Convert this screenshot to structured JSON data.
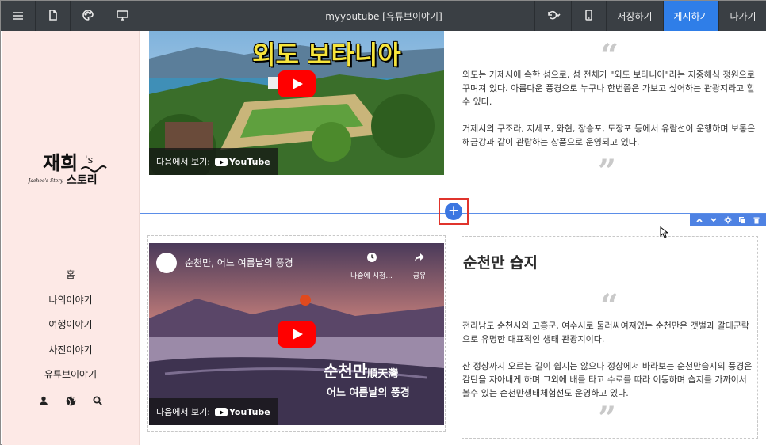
{
  "toolbar": {
    "title": "myyoutube [유튜브이야기]",
    "undo_label": "",
    "save_label": "저장하기",
    "publish_label": "게시하기",
    "exit_label": "나가기"
  },
  "sidebar": {
    "logo_text": "재희's 스토리",
    "items": [
      {
        "label": "홈"
      },
      {
        "label": "나의이야기"
      },
      {
        "label": "여행이야기"
      },
      {
        "label": "사진이야기"
      },
      {
        "label": "유튜브이야기"
      }
    ],
    "icons": [
      "user-icon",
      "globe-icon",
      "search-icon"
    ]
  },
  "block1": {
    "video_title": "외도 보타니아",
    "watch_on": "다음에서 보기:",
    "youtube": "YouTube",
    "para1": "외도는 거제시에 속한 섬으로, 섬 전체가 \"외도 보타니아\"라는 지중해식 정원으로 꾸며져 있다. 아름다운 풍경으로 누구나 한번쯤은 가보고 싶어하는 관광지라고 할수 있다.",
    "para2": "거제시의 구조라, 지세포, 와현, 장승포, 도장포 등에서 유람선이 운행하며 보통은 해금강과 같이 관람하는 상품으로 운영되고 있다."
  },
  "block2": {
    "channel_title": "순천만, 어느 여름날의 풍경",
    "watch_later": "나중에 시청...",
    "share": "공유",
    "overlay_line1": "순천만",
    "overlay_hanja": "順天灣",
    "overlay_line2": "어느 여름날의 풍경",
    "watch_on": "다음에서 보기:",
    "youtube": "YouTube",
    "heading": "순천만 습지",
    "para1": "전라남도 순천시와 고흥군, 여수시로 둘러싸여져있는 순천만은 갯벌과 갈대군락으로 유명한 대표적인 생태 관광지이다.",
    "para2": "산 정상까지 오르는 길이 쉽지는 않으나 정상에서 바라보는 순천만습지의 풍경은 감탄을 자아내게 하며 그외에 배를 타고 수로를 따라 이동하며 습지를 가까이서 볼수 있는 순천만생태체험선도 운영하고 있다."
  },
  "colors": {
    "accent": "#2f7ee8",
    "toolbar_bg": "#3a3f44",
    "sidebar_bg": "#fde9e6",
    "highlight_border": "#e0342c"
  }
}
